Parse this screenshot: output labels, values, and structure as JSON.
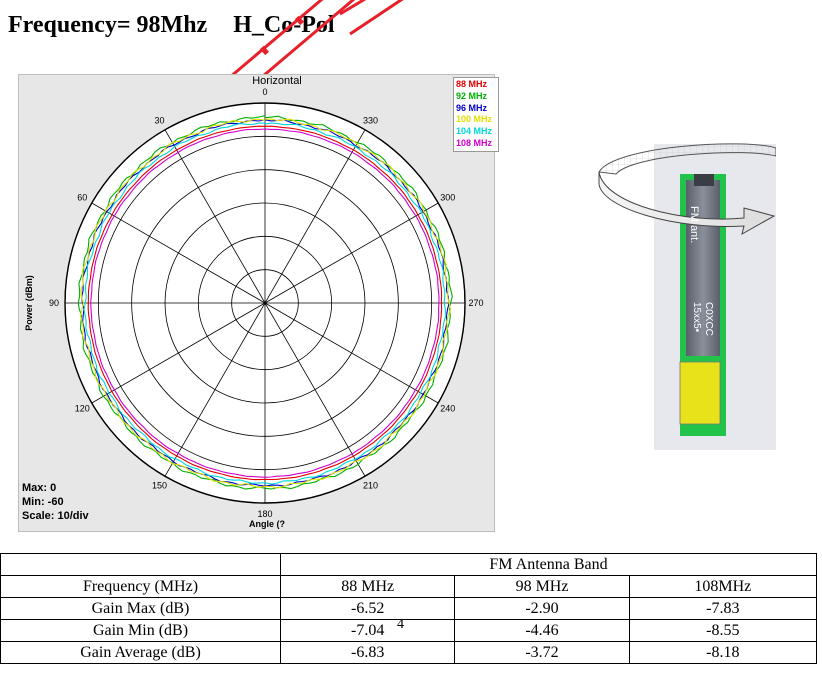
{
  "heading": {
    "frequency_label": "Frequency= 98Mhz",
    "polarization": "H_Co-Pol"
  },
  "chart_data": {
    "type": "polar",
    "title": "Horizontal",
    "radial_label": "Power  (dBm)",
    "angular_label": "Angle  (?",
    "angle_direction": "counterclockwise",
    "zero_angle": "top",
    "angle_ticks": [
      "0",
      "30",
      "60",
      "90",
      "120",
      "150",
      "180",
      "210",
      "240",
      "270",
      "300",
      "330"
    ],
    "radial_range": [
      -60,
      0
    ],
    "radial_step": 10,
    "grid": true,
    "legend_position": "top-right",
    "stats": {
      "max": "Max: 0",
      "min": "Min: -60",
      "scale": "Scale: 10/div"
    },
    "series": [
      {
        "name": "88 MHz",
        "color": "#e00000",
        "level": -7.0,
        "ripple": 0.1
      },
      {
        "name": "92 MHz",
        "color": "#00b000",
        "level": -4.3,
        "ripple": 0.55
      },
      {
        "name": "96 MHz",
        "color": "#0000c8",
        "level": -5.2,
        "ripple": 0.45
      },
      {
        "name": "100 MHz",
        "color": "#e0e000",
        "level": -4.9,
        "ripple": 0.6
      },
      {
        "name": "104 MHz",
        "color": "#00d8d8",
        "level": -6.0,
        "ripple": 0.4
      },
      {
        "name": "108 MHz",
        "color": "#d000d0",
        "level": -7.8,
        "ripple": 0.12
      }
    ]
  },
  "photo": {
    "label_line1": "FM ant.",
    "label_line2": "C0XCC",
    "label_line3": "15xx5•"
  },
  "table": {
    "group_header": "FM Antenna Band",
    "columns": [
      "Frequency (MHz)",
      "88 MHz",
      "98 MHz",
      "108MHz"
    ],
    "rows": [
      [
        "Gain Max (dB)",
        "-6.52",
        "-2.90",
        "-7.83"
      ],
      [
        "Gain Min (dB)",
        "-7.04",
        "-4.46",
        "-8.55"
      ],
      [
        "Gain Average (dB)",
        "-6.83",
        "-3.72",
        "-8.18"
      ]
    ]
  },
  "page_number": "4",
  "colors": {
    "watermark": "#e8202a",
    "pcb_green": "#22c34a",
    "pad_yellow": "#e8e21a",
    "chip_gray": "#6e7480"
  }
}
